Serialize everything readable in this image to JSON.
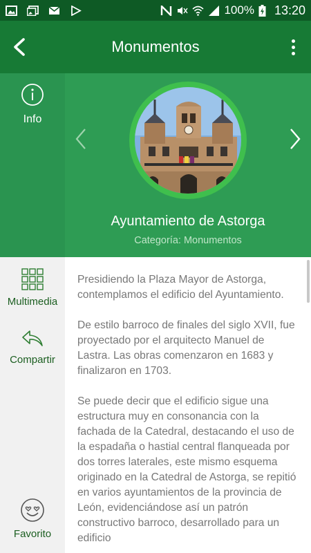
{
  "status_bar": {
    "battery": "100%",
    "time": "13:20"
  },
  "app_bar": {
    "title": "Monumentos",
    "back_icon": "chevron-left-icon",
    "menu_icon": "more-vert-icon"
  },
  "header": {
    "info_label": "Info",
    "title": "Ayuntamiento de Astorga",
    "category": "Categoría: Monumentos"
  },
  "side_menu": {
    "multimedia_label": "Multimedia",
    "share_label": "Compartir",
    "favorite_label": "Favorito"
  },
  "content": {
    "paragraphs": [
      "Presidiendo la Plaza Mayor de Astorga, contemplamos el edificio del Ayuntamiento.",
      "De estilo barroco de finales del siglo XVII, fue proyectado por el arquitecto Manuel de Lastra. Las obras comenzaron en 1683 y finalizaron en 1703.",
      "Se puede decir que el edificio sigue una estructura muy en consonancia con la fachada de la Catedral, destacando el uso de la espadaña o hastial central flanqueada por dos torres laterales, este mismo esquema originado en la Catedral de Astorga, se repitió en varios ayuntamientos de la provincia de León, evidenciándose así un patrón constructivo barroco, desarrollado para un edificio"
    ]
  },
  "colors": {
    "status_bar": "#0e5a25",
    "app_bar": "#177a35",
    "header": "#2e9c54",
    "ring": "#3fbf4d",
    "side_text": "#1b5e20"
  }
}
